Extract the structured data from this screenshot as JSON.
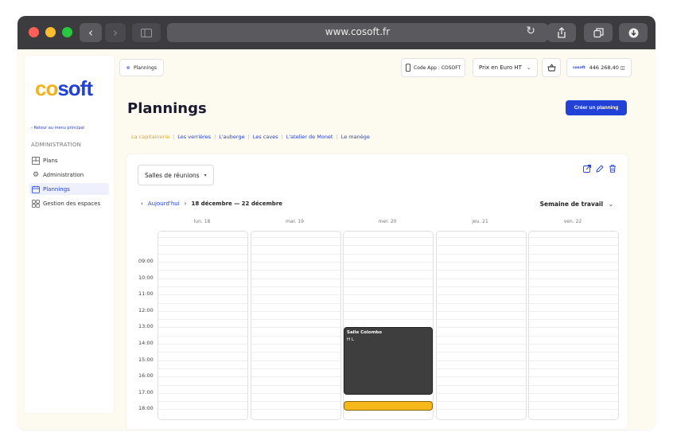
{
  "browser": {
    "url": "www.cosoft.fr",
    "colors": {
      "close": "#ff5f57",
      "minimize": "#febc2e",
      "maximize": "#28c840"
    }
  },
  "sidebar": {
    "logo_prefix": "co",
    "logo_suffix": "soft",
    "back_link": "Retour au menu principal",
    "section_label": "ADMINISTRATION",
    "items": [
      {
        "label": "Plans",
        "icon": "floorplan-icon"
      },
      {
        "label": "Administration",
        "icon": "gear-icon"
      },
      {
        "label": "Plannings",
        "icon": "calendar-icon",
        "active": true
      },
      {
        "label": "Gestion des espaces",
        "icon": "grid-icon"
      }
    ]
  },
  "header": {
    "breadcrumb": "Plannings",
    "app_code_label": "Code App : COSOFT",
    "price_select": "Prix en Euro HT",
    "balance": "446 268,40",
    "balance_brand": "cosoft"
  },
  "page": {
    "title": "Plannings",
    "create_button": "Créer un planning"
  },
  "tabs": [
    {
      "label": "La capitainerie",
      "active": true
    },
    {
      "label": "Les verrières"
    },
    {
      "label": "L'auberge"
    },
    {
      "label": "Les caves"
    },
    {
      "label": "L'atelier de Monet"
    },
    {
      "label": "Le manège"
    }
  ],
  "calendar": {
    "room_select": "Salles de réunions",
    "today_label": "Aujourd'hui",
    "week_range": "18 décembre — 22 décembre",
    "view_select": "Semaine de travail",
    "days": [
      "lun. 18",
      "mar. 19",
      "mer. 20",
      "jeu. 21",
      "ven. 22"
    ],
    "hours": [
      "09:00",
      "10:00",
      "11:00",
      "12:00",
      "13:00",
      "14:00",
      "15:00",
      "16:00",
      "17:00",
      "18:00"
    ],
    "events": [
      {
        "title": "Salle Colombo",
        "subtitle": "H L",
        "day": 2,
        "start": 13.5,
        "end": 17.5,
        "color": "#3e3e3e"
      },
      {
        "title": "",
        "subtitle": "",
        "day": 2,
        "start": 18.0,
        "end": 18.5,
        "color": "#f7b81b"
      }
    ]
  }
}
